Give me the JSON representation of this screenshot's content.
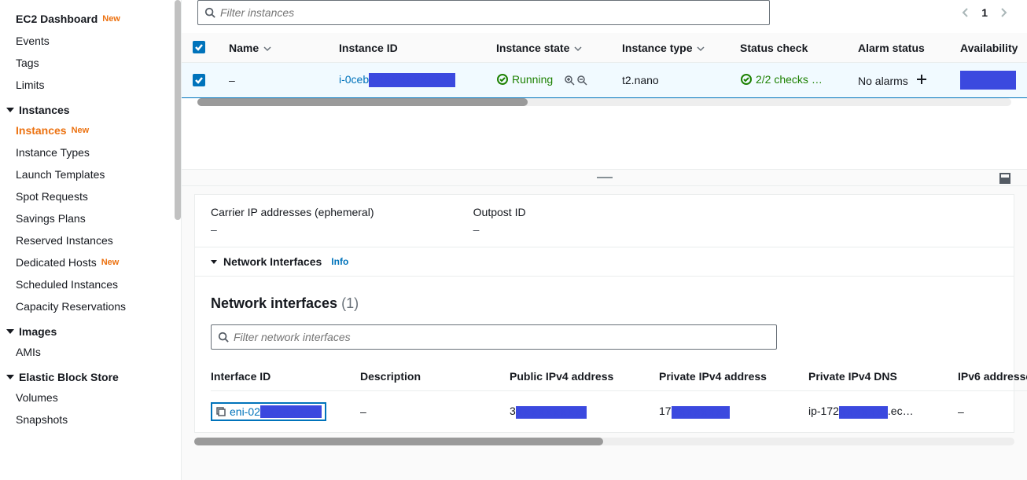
{
  "sidebar": {
    "items": [
      {
        "label": "EC2 Dashboard",
        "new": true
      },
      {
        "label": "Events"
      },
      {
        "label": "Tags"
      },
      {
        "label": "Limits"
      }
    ],
    "sections": [
      {
        "title": "Instances",
        "items": [
          {
            "label": "Instances",
            "new": true,
            "active": true
          },
          {
            "label": "Instance Types"
          },
          {
            "label": "Launch Templates"
          },
          {
            "label": "Spot Requests"
          },
          {
            "label": "Savings Plans"
          },
          {
            "label": "Reserved Instances"
          },
          {
            "label": "Dedicated Hosts",
            "new": true
          },
          {
            "label": "Scheduled Instances"
          },
          {
            "label": "Capacity Reservations"
          }
        ]
      },
      {
        "title": "Images",
        "items": [
          {
            "label": "AMIs"
          }
        ]
      },
      {
        "title": "Elastic Block Store",
        "items": [
          {
            "label": "Volumes"
          },
          {
            "label": "Snapshots"
          }
        ]
      }
    ]
  },
  "filter": {
    "placeholder": "Filter instances"
  },
  "pager": {
    "page": "1"
  },
  "table": {
    "headers": [
      "Name",
      "Instance ID",
      "Instance state",
      "Instance type",
      "Status check",
      "Alarm status",
      "Availability"
    ],
    "row": {
      "name": "–",
      "instance_id_prefix": "i-0ceb",
      "state": "Running",
      "type": "t2.nano",
      "status": "2/2 checks …",
      "alarm": "No alarms"
    }
  },
  "details": {
    "carrier_label": "Carrier IP addresses (ephemeral)",
    "carrier_val": "–",
    "outpost_label": "Outpost ID",
    "outpost_val": "–",
    "ni_section": "Network Interfaces",
    "info": "Info",
    "ni_title": "Network interfaces",
    "ni_count": "(1)",
    "ni_filter_placeholder": "Filter network interfaces",
    "ni_headers": [
      "Interface ID",
      "Description",
      "Public IPv4 address",
      "Private IPv4 address",
      "Private IPv4 DNS",
      "IPv6 addresse"
    ],
    "ni_row": {
      "id_prefix": "eni-02",
      "desc": "–",
      "pub_prefix": "3",
      "priv_prefix": "17",
      "dns_prefix": "ip-172",
      "dns_suffix": ".ec…",
      "ipv6": "–"
    }
  },
  "new_label": "New"
}
